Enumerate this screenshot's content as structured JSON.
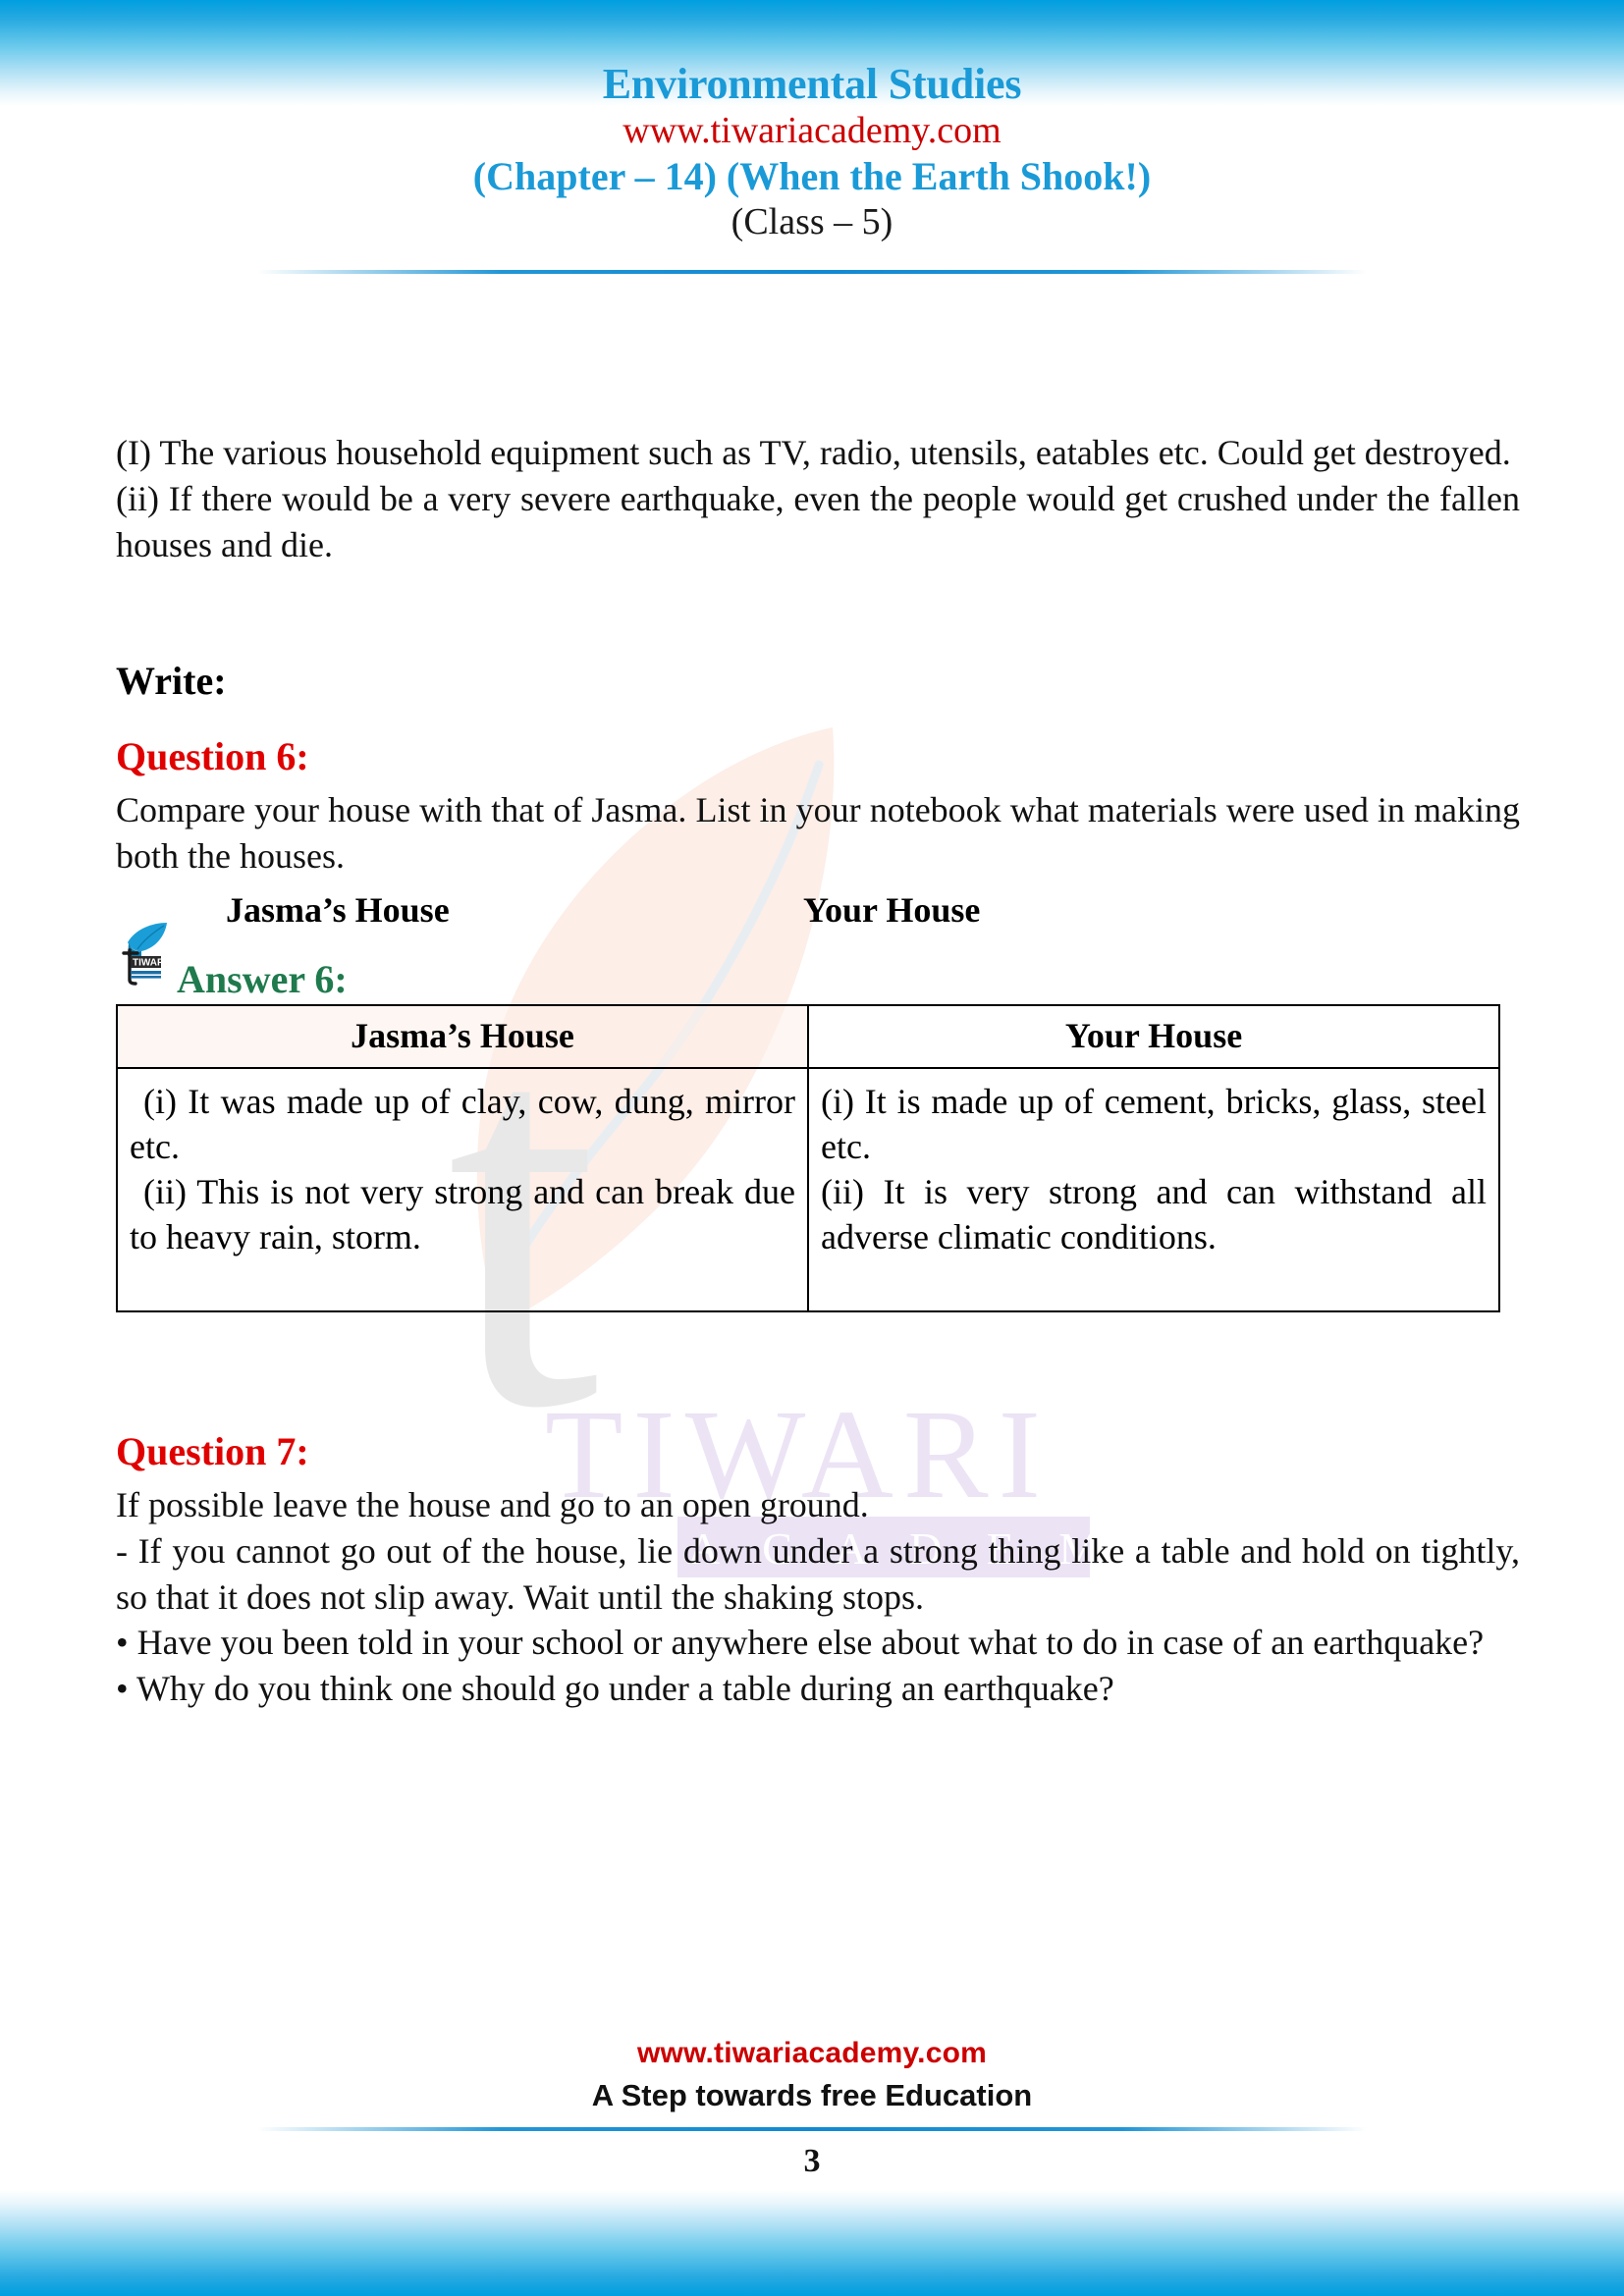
{
  "page": {
    "accent_blue": "#1a9ad7",
    "accent_red": "#cc0000",
    "accent_green": "#1f7a4d",
    "question_red": "#e00000"
  },
  "header": {
    "subject": "Environmental Studies",
    "website": "www.tiwariacademy.com",
    "chapter": "(Chapter – 14) (When the Earth Shook!)",
    "class": "(Class – 5)"
  },
  "intro": {
    "line1": "(I) The various household equipment such as TV, radio, utensils, eatables etc. Could get destroyed.",
    "line2": "(ii) If there would be a very severe earthquake, even the people would get crushed under the fallen houses and die."
  },
  "write_heading": "Write:",
  "question6": {
    "label": "Question 6:",
    "text": "Compare your house with that of Jasma. List in your notebook what materials were used in making both the houses.",
    "caption_left": "Jasma’s House",
    "caption_right": "Your House"
  },
  "answer6": {
    "label": "Answer 6:",
    "table": {
      "headers": [
        "Jasma’s House",
        "Your House"
      ],
      "rows": [
        {
          "col1": [
            "(i) It was made up of clay, cow, dung, mirror etc.",
            "(ii) This is not very strong and can break due to heavy rain, storm."
          ],
          "col2": [
            "(i) It is made up of cement, bricks, glass, steel etc.",
            "(ii) It is very strong and can withstand all adverse climatic conditions."
          ]
        }
      ]
    }
  },
  "question7": {
    "label": "Question 7:",
    "line1": "If possible leave the house and go to an open ground.",
    "line2": "- If you cannot go out of the house, lie down under a strong thing like a table and hold on tightly, so that it does not slip away. Wait until the shaking stops.",
    "bullet1": "• Have you been told in your school or anywhere else about what to do in case of an earthquake?",
    "bullet2": "•  Why do you think one should go under a table during an earthquake?"
  },
  "watermark": {
    "brand_letter": "t",
    "brand_name": "TIWARI",
    "brand_sub": "A C A D E M Y"
  },
  "logo": {
    "name": "TIWARI"
  },
  "footer": {
    "website": "www.tiwariacademy.com",
    "tagline": "A Step towards free Education",
    "page_number": "3"
  }
}
